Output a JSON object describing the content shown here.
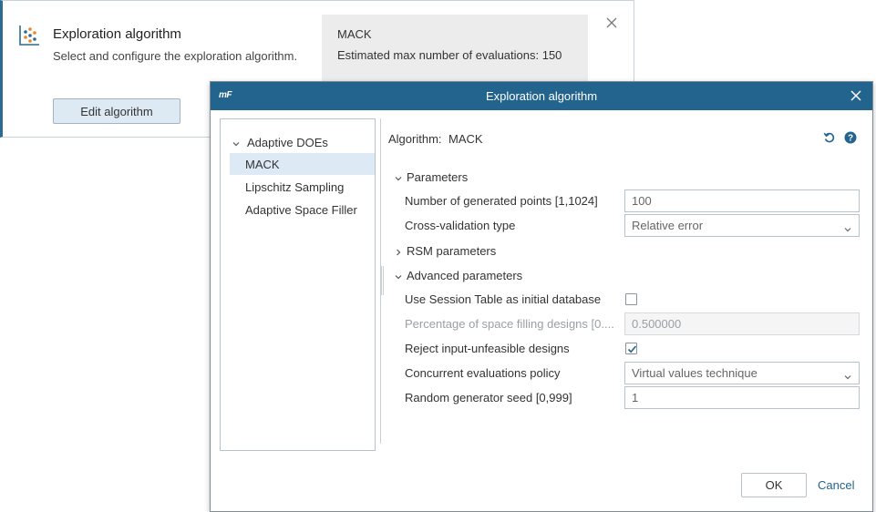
{
  "card": {
    "title": "Exploration algorithm",
    "subtitle": "Select and configure the exploration algorithm.",
    "edit_button_label": "Edit algorithm",
    "info_algorithm": "MACK",
    "info_estimate": "Estimated max number of evaluations: 150",
    "icon": "scatter-chart-icon"
  },
  "dialog": {
    "logo": "mF",
    "title": "Exploration algorithm",
    "tree": {
      "group_label": "Adaptive DOEs",
      "items": [
        {
          "label": "MACK",
          "selected": true
        },
        {
          "label": "Lipschitz Sampling",
          "selected": false
        },
        {
          "label": "Adaptive Space Filler",
          "selected": false
        }
      ]
    },
    "algorithm_label": "Algorithm:",
    "algorithm_value": "MACK",
    "sections": {
      "parameters": "Parameters",
      "rsm": "RSM parameters",
      "advanced": "Advanced parameters"
    },
    "fields": {
      "generated_points": {
        "label": "Number of generated points [1,1024]",
        "value": "100"
      },
      "cross_validation": {
        "label": "Cross-validation type",
        "value": "Relative error"
      },
      "use_session_table": {
        "label": "Use Session Table as initial database",
        "checked": false
      },
      "space_filling": {
        "label": "Percentage of space filling designs [0....",
        "value": "0.500000",
        "disabled": true
      },
      "reject_infeasible": {
        "label": "Reject input-unfeasible designs",
        "checked": true
      },
      "concurrent_policy": {
        "label": "Concurrent evaluations policy",
        "value": "Virtual values technique"
      },
      "random_seed": {
        "label": "Random generator seed [0,999]",
        "value": "1"
      }
    },
    "ok_label": "OK",
    "cancel_label": "Cancel"
  },
  "colors": {
    "titlebar": "#23648f",
    "accent": "#2b6a94",
    "selection": "#dde9f4",
    "link": "#23648f"
  }
}
